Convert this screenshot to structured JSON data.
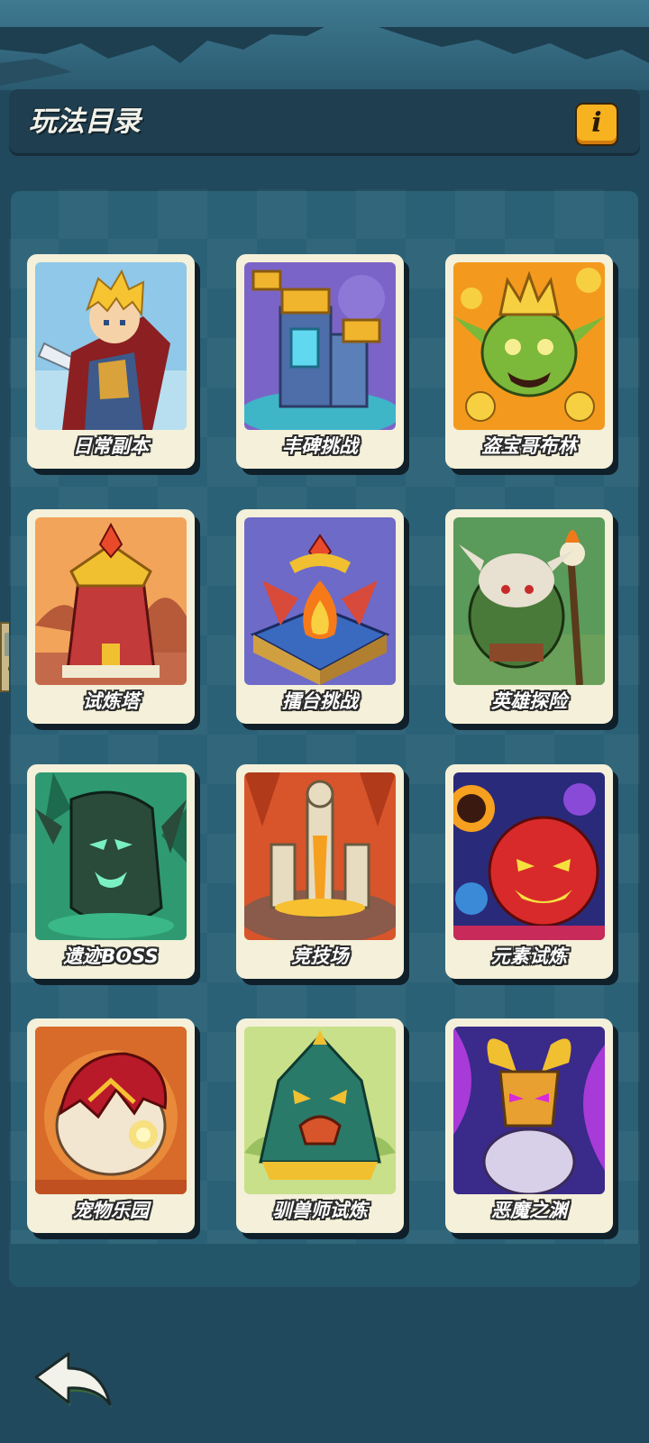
{
  "header": {
    "title": "玩法目录",
    "info_label": "i"
  },
  "cards": [
    {
      "label": "日常副本",
      "icon": "hero-swordsman-art"
    },
    {
      "label": "丰碑挑战",
      "icon": "monument-tower-art"
    },
    {
      "label": "盗宝哥布林",
      "icon": "goblin-treasure-art"
    },
    {
      "label": "试炼塔",
      "icon": "trial-tower-art"
    },
    {
      "label": "擂台挑战",
      "icon": "arena-fire-altar-art"
    },
    {
      "label": "英雄探险",
      "icon": "orc-adventure-art"
    },
    {
      "label": "遗迹BOSS",
      "icon": "treant-boss-art"
    },
    {
      "label": "竞技场",
      "icon": "colosseum-art"
    },
    {
      "label": "元素试炼",
      "icon": "element-spirit-art"
    },
    {
      "label": "宠物乐园",
      "icon": "pet-egg-art"
    },
    {
      "label": "驯兽师试炼",
      "icon": "beast-totem-art"
    },
    {
      "label": "恶魔之渊",
      "icon": "demon-abyss-art"
    }
  ],
  "footer": {
    "back_icon": "back-arrow-icon"
  }
}
